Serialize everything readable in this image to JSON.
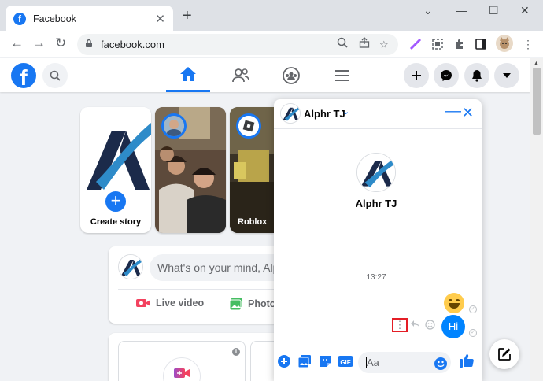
{
  "browser": {
    "tab_title": "Facebook",
    "tab_close": "✕",
    "new_tab": "+",
    "url": "facebook.com",
    "window_controls": [
      "⌄",
      "—",
      "☐",
      "✕"
    ]
  },
  "facebook": {
    "logo": "f",
    "stories": {
      "create_label": "Create story",
      "plus": "+",
      "items": [
        {
          "name": ""
        },
        {
          "name": "Roblox"
        }
      ]
    },
    "composer": {
      "placeholder": "What's on your mind, Alph",
      "actions": [
        {
          "label": "Live video",
          "icon": "live-video-icon",
          "color": "#f3425f"
        },
        {
          "label": "Photo",
          "icon": "photo-icon",
          "color": "#45bd62"
        }
      ],
      "info": "i"
    }
  },
  "chat": {
    "name": "Alphr TJ",
    "chevron": "⌄",
    "minimize": "—",
    "close": "✕",
    "profile_name": "Alphr TJ",
    "timestamp": "13:27",
    "messages": [
      {
        "type": "emoji",
        "content": "grinning-face"
      },
      {
        "type": "text",
        "content": "Hi"
      }
    ],
    "more_options": "⋮",
    "input_placeholder": "Aa",
    "seen_mark": "✓"
  },
  "colors": {
    "facebook_blue": "#1877f2",
    "messenger_blue": "#0084ff",
    "highlight_red": "#e41e26"
  }
}
